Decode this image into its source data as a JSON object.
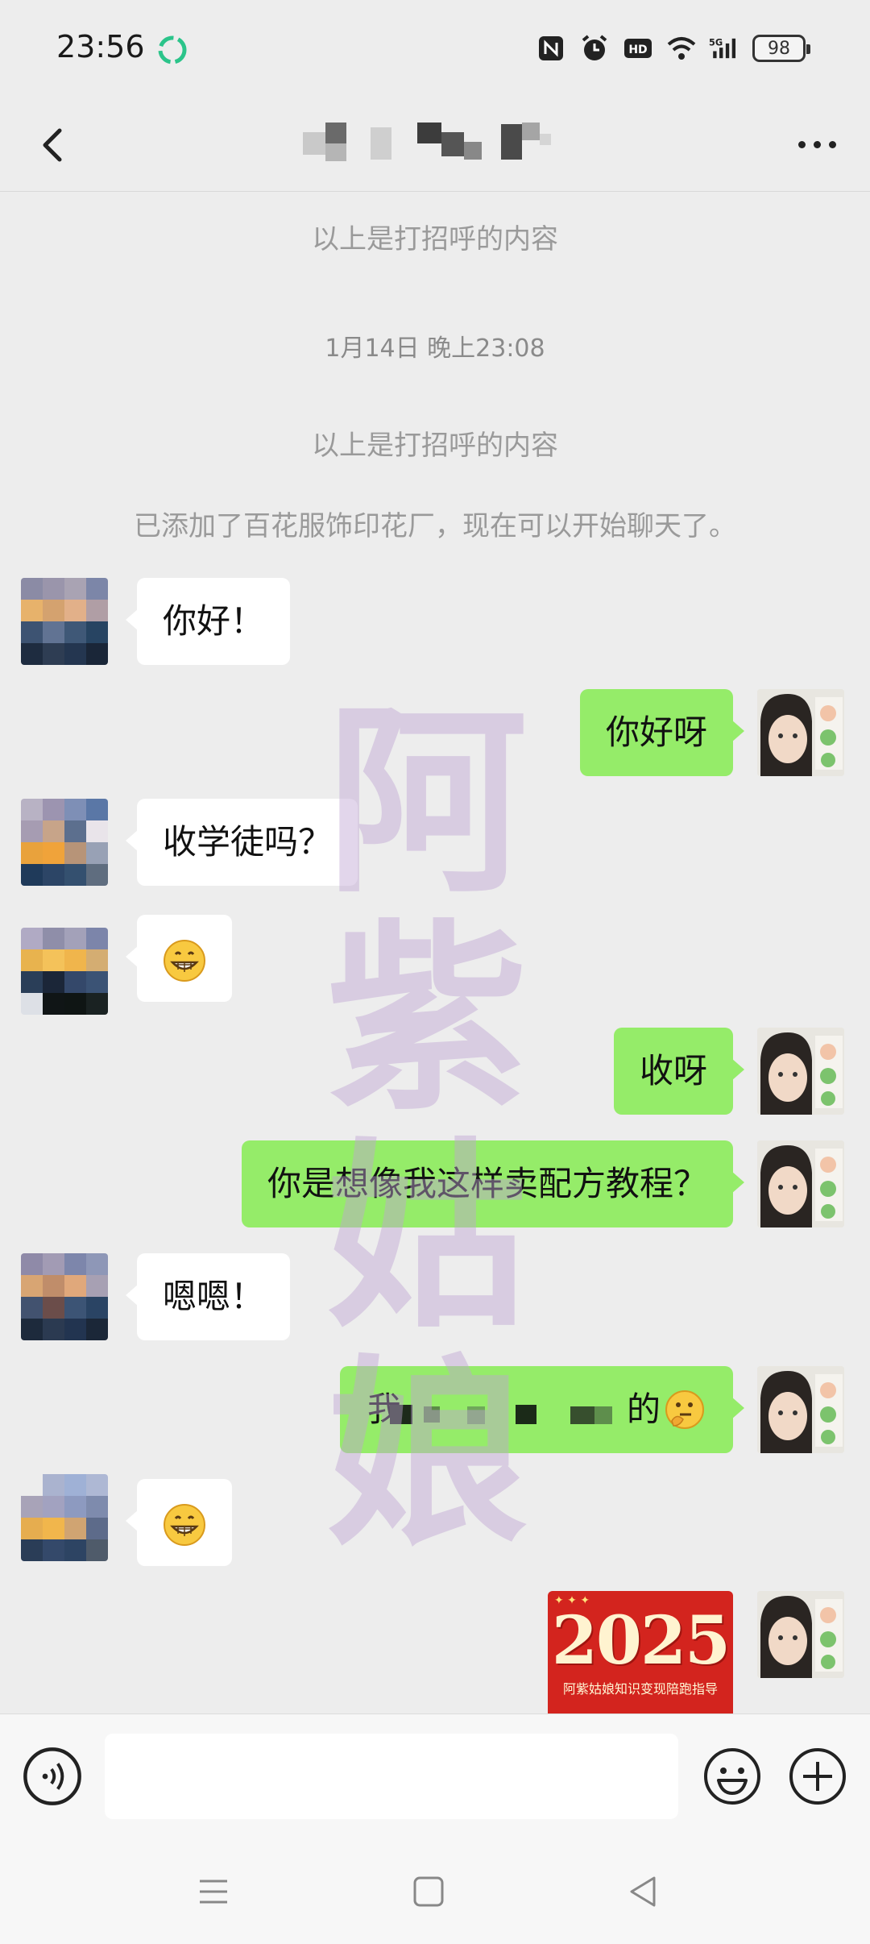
{
  "status_bar": {
    "time": "23:56",
    "battery": "98",
    "icons": [
      "app-notification-icon",
      "nfc-icon",
      "alarm-icon",
      "hd-icon",
      "wifi-icon",
      "5g-signal-icon",
      "battery-icon"
    ]
  },
  "nav": {
    "back_icon": "chevron-left-icon",
    "title_obscured": true,
    "more_icon": "more-horizontal-icon"
  },
  "system_messages": {
    "greeting_note_1": "以上是打招呼的内容",
    "timestamp": "1月14日 晚上23:08",
    "greeting_note_2": "以上是打招呼的内容",
    "friend_added": "已添加了百花服饰印花厂，现在可以开始聊天了。"
  },
  "messages": [
    {
      "side": "in",
      "text": "你好！"
    },
    {
      "side": "out",
      "text": "你好呀"
    },
    {
      "side": "in",
      "text": "收学徒吗？"
    },
    {
      "side": "in",
      "emoji": "grinning-face-icon"
    },
    {
      "side": "out",
      "text": "收呀"
    },
    {
      "side": "out",
      "text": "你是想像我这样卖配方教程？"
    },
    {
      "side": "in",
      "text": "嗯嗯！"
    },
    {
      "side": "out",
      "text_start": "我",
      "text_end": "的",
      "emoji": "thinking-face-icon",
      "obscured": true
    },
    {
      "side": "in",
      "emoji": "grinning-face-icon"
    },
    {
      "side": "out",
      "image": "poster-image",
      "poster_year": "2025",
      "poster_subtitle": "阿紫姑娘知识变现陪跑指导"
    }
  ],
  "watermark": [
    "阿",
    "紫",
    "姑",
    "娘"
  ],
  "input_bar": {
    "voice_icon": "voice-input-icon",
    "input_placeholder": "",
    "emoji_icon": "emoji-icon",
    "plus_icon": "plus-circle-icon"
  },
  "system_nav": {
    "menu_icon": "menu-icon",
    "home_icon": "home-square-icon",
    "back_icon": "back-triangle-icon"
  },
  "colors": {
    "background": "#ededed",
    "incoming_bubble": "#ffffff",
    "outgoing_bubble": "#95ec69",
    "system_text": "#9a9a9a",
    "watermark": "#bea5d2"
  }
}
